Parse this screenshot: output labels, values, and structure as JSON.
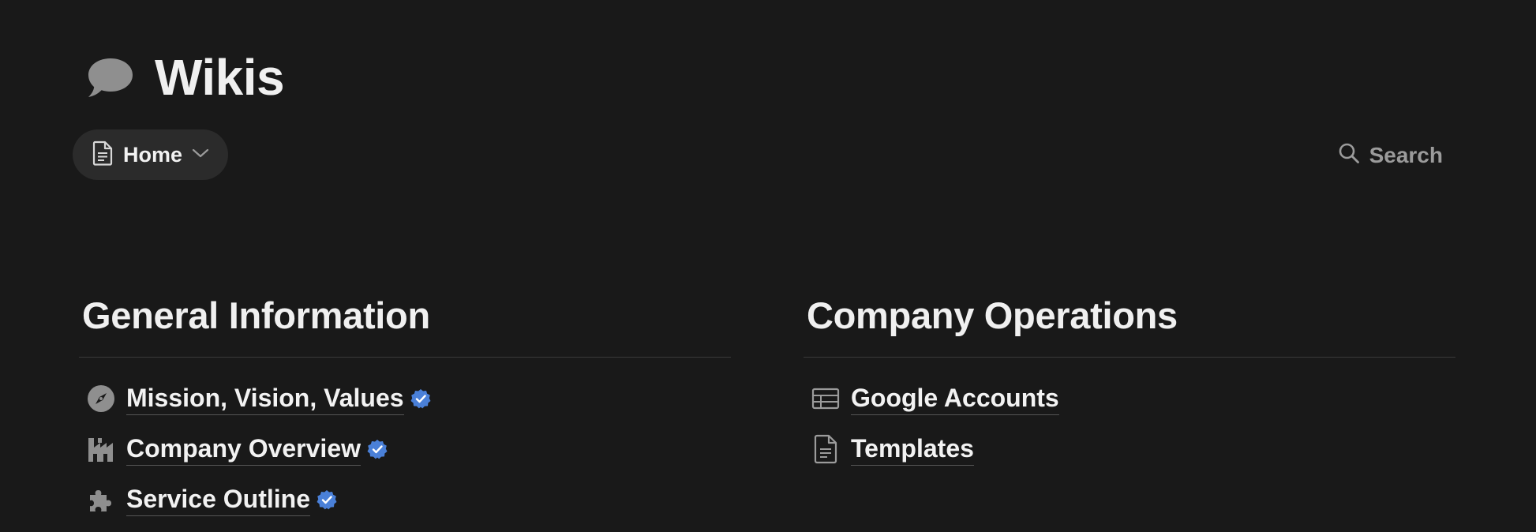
{
  "page": {
    "title": "Wikis",
    "icon": "speech-bubble-icon"
  },
  "view_tab": {
    "label": "Home",
    "icon": "page-icon"
  },
  "search": {
    "label": "Search",
    "icon": "search-icon"
  },
  "colors": {
    "background": "#191919",
    "verified": "#4a80d8",
    "icon_gray": "#9b9b9b"
  },
  "sections": [
    {
      "heading": "General Information",
      "items": [
        {
          "label": "Mission, Vision, Values",
          "icon": "compass-icon",
          "verified": true
        },
        {
          "label": "Company Overview",
          "icon": "factory-icon",
          "verified": true
        },
        {
          "label": "Service Outline",
          "icon": "puzzle-icon",
          "verified": true
        }
      ]
    },
    {
      "heading": "Company Operations",
      "items": [
        {
          "label": "Google Accounts",
          "icon": "table-icon",
          "verified": false
        },
        {
          "label": "Templates",
          "icon": "page-icon",
          "verified": false
        }
      ]
    }
  ]
}
